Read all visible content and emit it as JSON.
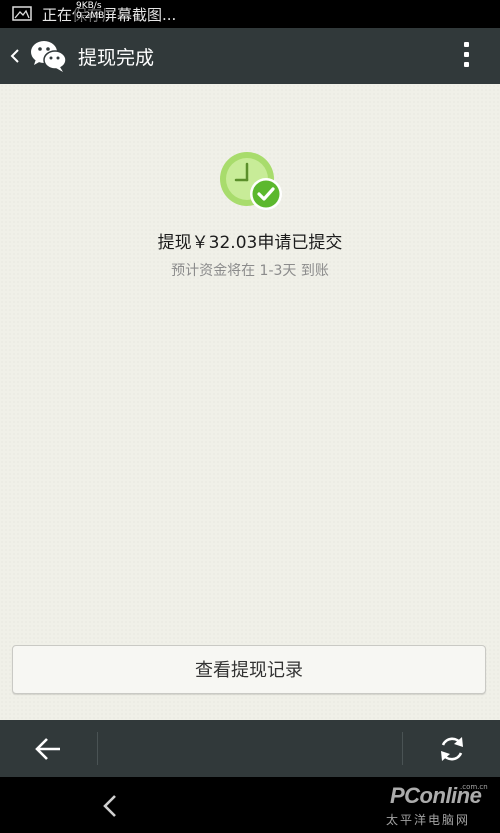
{
  "status_bar": {
    "notification_text": "正在保存屏幕截图...",
    "speed_up": "9KB/s",
    "speed_down": "0.2MB",
    "image_icon": "image-icon"
  },
  "action_bar": {
    "title": "提现完成",
    "back_icon": "chevron-left-icon",
    "logo_icon": "wechat-logo-icon",
    "menu_icon": "more-vert-icon"
  },
  "content": {
    "status_icon": "clock-check-icon",
    "headline": "提现￥32.03申请已提交",
    "subline": "预计资金将在 1-3天 到账",
    "record_button_label": "查看提现记录"
  },
  "bottom_bar": {
    "back_icon": "arrow-left-icon",
    "refresh_icon": "refresh-icon"
  },
  "nav_bar": {
    "back_icon": "system-back-icon"
  },
  "watermark": {
    "brand": "PConline",
    "domain": ".com.cn",
    "subtitle": "太平洋电脑网"
  },
  "colors": {
    "toolbar": "#31393a",
    "background": "#f0f0e8",
    "accent_green": "#8bcf4a",
    "check_green": "#5cb82e"
  }
}
